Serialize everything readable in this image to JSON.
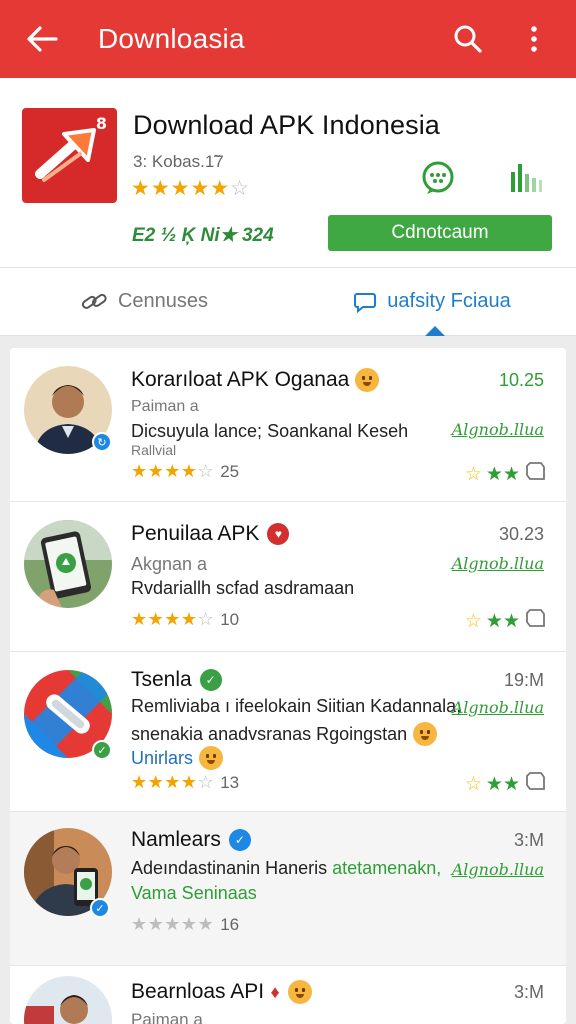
{
  "appbar": {
    "title": "Downloasia",
    "icons": [
      "back-arrow-icon",
      "search-icon",
      "more-vert-icon"
    ],
    "color": "#e53935"
  },
  "app": {
    "logo_number": "8",
    "name": "Download APK Indonesia",
    "version": "3: Kobas.1̃7",
    "rating_stars": 5,
    "stats": "Ε2 ½ Ķ Ni★ 324",
    "download_label": "Cdnotcaum",
    "download_color": "#3fa843"
  },
  "tabs": [
    {
      "label": "Cennuses",
      "icon": "link-icon",
      "active": false
    },
    {
      "label": "uafsity Fciaua",
      "icon": "chat-bubble-icon",
      "active": true
    }
  ],
  "reviews": [
    {
      "name": "Korarıloat APK Oganaa",
      "time": "10.25",
      "sub": "Paiman a",
      "body": "Dicsuyula lance; Soankanal Keseh",
      "extra": "Rallvial",
      "signature": "Algnob.llua",
      "stars": "★★★★☆",
      "count": "25",
      "action_stars": "☆★★"
    },
    {
      "name": "Penuilaa APK",
      "time": "30.23",
      "sub": "Akgnan a",
      "body": "Rvdariallh scfad asdramaan",
      "signature": "Algnob.llua",
      "stars": "★★★★☆",
      "count": "10",
      "action_stars": "☆★★"
    },
    {
      "name": "Tsenla",
      "time": "19:M",
      "body": "Remliviaba ı ifeelokain Siitian Kadannala,",
      "body2": "snenakia anadvsranas Rgoingstan",
      "link": "Unirlars",
      "signature": "Algnob.llua",
      "stars": "★★★★☆",
      "count": "13",
      "action_stars": "☆★★"
    },
    {
      "name": "Namlears",
      "time": "3:M",
      "body_a": "Adeındastinanin Haneris",
      "body_b": "atetamenakn,",
      "link": "Vama Seninaas",
      "signature": "Algnob.llua",
      "stars": "★★★★★",
      "count": "16"
    },
    {
      "name": "Bearnloas API",
      "time": "3:M",
      "sub": "Paiman a"
    }
  ]
}
